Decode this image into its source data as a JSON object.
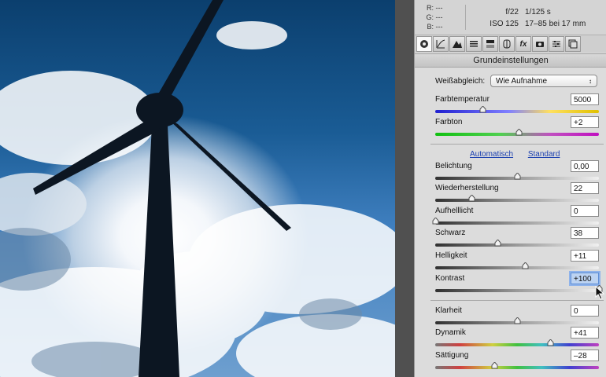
{
  "info": {
    "rgb": [
      {
        "label": "R:",
        "value": "---"
      },
      {
        "label": "G:",
        "value": "---"
      },
      {
        "label": "B:",
        "value": "---"
      }
    ],
    "aperture": "f/22",
    "shutter": "1/125 s",
    "iso": "ISO 125",
    "lens": "17–85 bei 17 mm"
  },
  "tabs": [
    "circle-icon",
    "curve-icon",
    "mountain-icon",
    "bars-icon",
    "split-icon",
    "lens-icon",
    "fx-icon",
    "camera-icon",
    "sliders-icon",
    "preset-icon"
  ],
  "section_title": "Grundeinstellungen",
  "white_balance": {
    "label": "Weißabgleich:",
    "value": "Wie Aufnahme"
  },
  "links": {
    "auto": "Automatisch",
    "standard": "Standard"
  },
  "sliders": [
    {
      "id": "farbtemperatur",
      "label": "Farbtemperatur",
      "value": "5000",
      "pos": 0.29,
      "track": "temp"
    },
    {
      "id": "farbton",
      "label": "Farbton",
      "value": "+2",
      "pos": 0.51,
      "track": "tint"
    },
    {
      "id": "belichtung",
      "label": "Belichtung",
      "value": "0,00",
      "pos": 0.5,
      "track": "gray"
    },
    {
      "id": "wiederherstellung",
      "label": "Wiederherstellung",
      "value": "22",
      "pos": 0.22,
      "track": "gray"
    },
    {
      "id": "aufhelllicht",
      "label": "Aufhelllicht",
      "value": "0",
      "pos": 0.0,
      "track": "gray"
    },
    {
      "id": "schwarz",
      "label": "Schwarz",
      "value": "38",
      "pos": 0.38,
      "track": "gray"
    },
    {
      "id": "helligkeit",
      "label": "Helligkeit",
      "value": "+11",
      "pos": 0.55,
      "track": "gray"
    },
    {
      "id": "kontrast",
      "label": "Kontrast",
      "value": "+100",
      "pos": 1.0,
      "track": "gray",
      "focused": true
    },
    {
      "id": "klarheit",
      "label": "Klarheit",
      "value": "0",
      "pos": 0.5,
      "track": "gray"
    },
    {
      "id": "dynamik",
      "label": "Dynamik",
      "value": "+41",
      "pos": 0.7,
      "track": "rainbow"
    },
    {
      "id": "saettigung",
      "label": "Sättigung",
      "value": "–28",
      "pos": 0.36,
      "track": "rainbow"
    }
  ],
  "colors": {
    "link": "#1a3fb0",
    "panel": "#dcdcdc",
    "sky": "#1a5c95"
  }
}
